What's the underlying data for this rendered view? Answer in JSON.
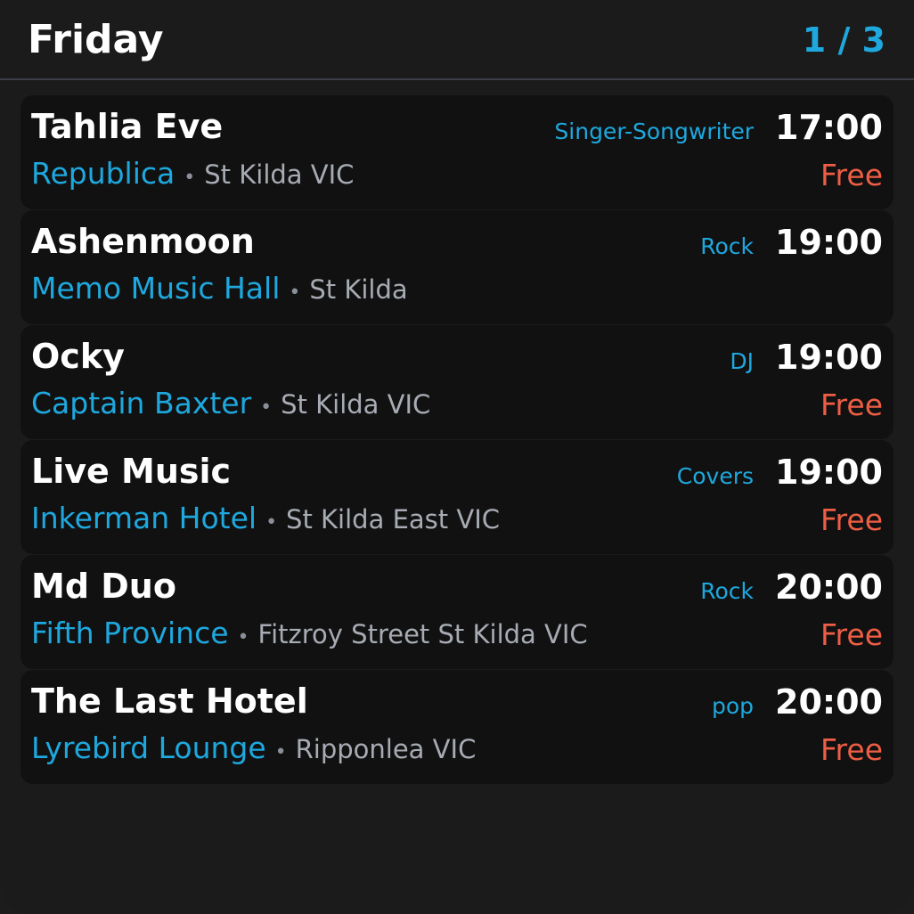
{
  "header": {
    "day": "Friday",
    "pager": "1 / 3"
  },
  "separator": "•",
  "gigs": [
    {
      "band": "Tahlia Eve",
      "genre": "Singer-Songwriter",
      "time": "17:00",
      "venue": "Republica",
      "suburb": "St Kilda VIC",
      "price": "Free"
    },
    {
      "band": "Ashenmoon",
      "genre": "Rock",
      "time": "19:00",
      "venue": "Memo Music Hall",
      "suburb": "St Kilda",
      "price": ""
    },
    {
      "band": "Ocky",
      "genre": "DJ",
      "time": "19:00",
      "venue": "Captain Baxter",
      "suburb": "St Kilda VIC",
      "price": "Free"
    },
    {
      "band": "Live Music",
      "genre": "Covers",
      "time": "19:00",
      "venue": "Inkerman Hotel",
      "suburb": "St Kilda East VIC",
      "price": "Free"
    },
    {
      "band": "Md Duo",
      "genre": "Rock",
      "time": "20:00",
      "venue": "Fifth Province",
      "suburb": "Fitzroy Street St Kilda VIC",
      "price": "Free"
    },
    {
      "band": "The Last Hotel",
      "genre": "pop",
      "time": "20:00",
      "venue": "Lyrebird Lounge",
      "suburb": "Ripponlea VIC",
      "price": "Free"
    }
  ],
  "colors": {
    "accent": "#1ea8de",
    "price": "#ee5e45",
    "card_bg": "#111111",
    "page_bg": "#1b1b1b"
  }
}
